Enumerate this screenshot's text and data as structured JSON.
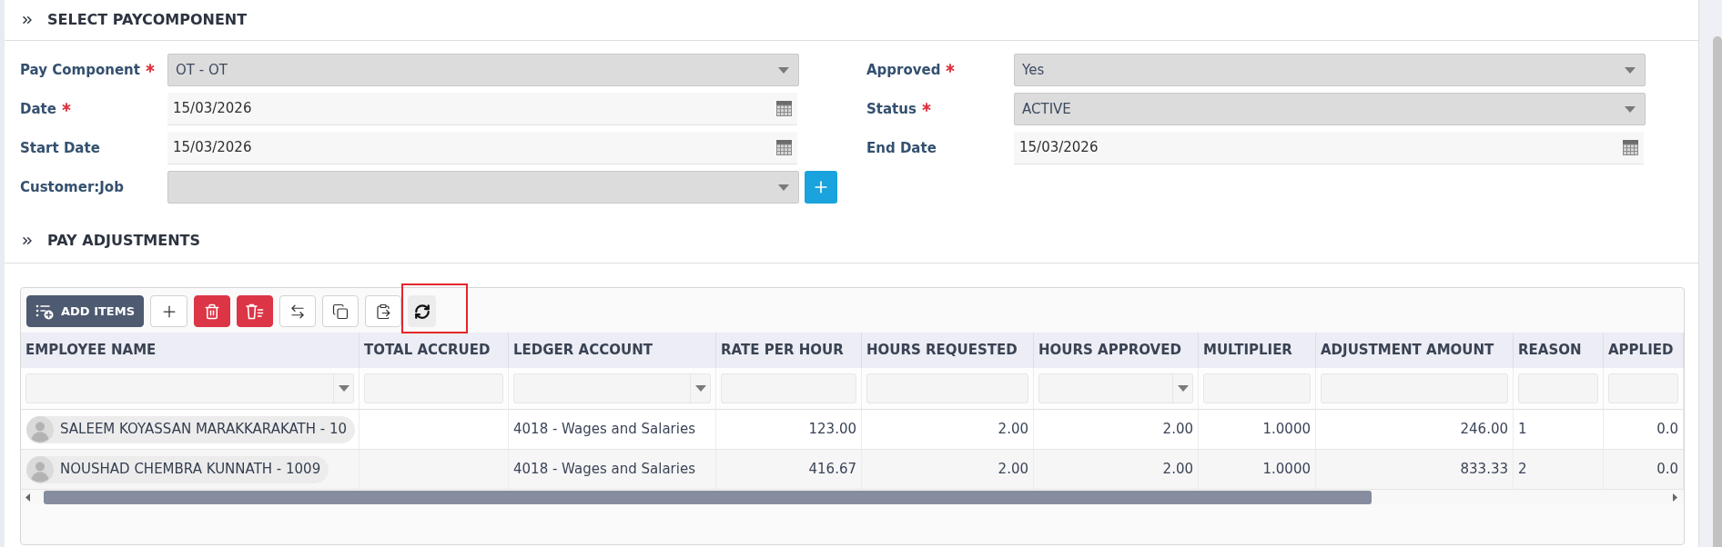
{
  "form": {
    "title": "SELECT PAYCOMPONENT",
    "left_fields": [
      {
        "label": "Pay Component",
        "required": true,
        "kind": "select",
        "value": "OT - OT",
        "add_button": false
      },
      {
        "label": "Date",
        "required": true,
        "kind": "date",
        "value": "15/03/2026",
        "add_button": false
      },
      {
        "label": "Start Date",
        "required": false,
        "kind": "date",
        "value": "15/03/2026",
        "add_button": false
      },
      {
        "label": "Customer:Job",
        "required": false,
        "kind": "select",
        "add_button": true
      }
    ],
    "right_fields": [
      {
        "label": "Approved",
        "required": true,
        "kind": "select",
        "value": "Yes",
        "add_button": false
      },
      {
        "label": "Status",
        "required": true,
        "kind": "select",
        "value": "ACTIVE",
        "add_button": false
      },
      {
        "label": "End Date",
        "required": false,
        "kind": "date",
        "value": "15/03/2026",
        "add_button": false
      }
    ]
  },
  "adjustments": {
    "title": "PAY ADJUSTMENTS",
    "toolbar": [
      {
        "kind": "add_items",
        "label": "ADD ITEMS",
        "highlighted": false
      },
      {
        "kind": "add",
        "highlighted": false
      },
      {
        "kind": "delete",
        "highlighted": false
      },
      {
        "kind": "delete_rows",
        "highlighted": false
      },
      {
        "kind": "swap",
        "highlighted": false
      },
      {
        "kind": "copy",
        "highlighted": false
      },
      {
        "kind": "paste",
        "highlighted": false
      },
      {
        "kind": "refresh",
        "highlighted": true
      }
    ],
    "columns": [
      {
        "label": "EMPLOYEE NAME",
        "kind": "employee",
        "filter_dropdown": true
      },
      {
        "label": "TOTAL ACCRUED",
        "filter_dropdown": false
      },
      {
        "label": "LEDGER ACCOUNT",
        "kind": "text",
        "filter_dropdown": true
      },
      {
        "label": "RATE PER HOUR",
        "kind": "number",
        "filter_dropdown": false
      },
      {
        "label": "HOURS REQUESTED",
        "kind": "number",
        "filter_dropdown": false
      },
      {
        "label": "HOURS APPROVED",
        "kind": "number",
        "filter_dropdown": true
      },
      {
        "label": "MULTIPLIER",
        "kind": "number",
        "filter_dropdown": false
      },
      {
        "label": "ADJUSTMENT AMOUNT",
        "kind": "number",
        "filter_dropdown": false
      },
      {
        "label": "REASON",
        "kind": "text",
        "filter_dropdown": false
      },
      {
        "label": "APPLIED",
        "kind": "number",
        "filter_dropdown": false
      }
    ],
    "rows": [
      {
        "cells": [
          "SALEEM KOYASSAN MARAKKARAKATH - 10",
          null,
          "4018 - Wages and Salaries",
          "123.00",
          "2.00",
          "2.00",
          "1.0000",
          "246.00",
          "1",
          "0.0"
        ]
      },
      {
        "cells": [
          "NOUSHAD CHEMBRA KUNNATH - 1009",
          null,
          "4018 - Wages and Salaries",
          "416.67",
          "2.00",
          "2.00",
          "1.0000",
          "833.33",
          "2",
          "0.0"
        ]
      }
    ]
  }
}
